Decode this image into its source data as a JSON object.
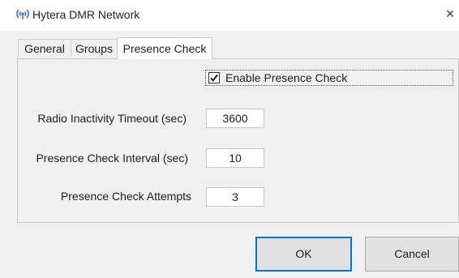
{
  "window": {
    "title": "Hytera DMR Network",
    "close_glyph": "×"
  },
  "tabs": [
    {
      "label": "General",
      "selected": false
    },
    {
      "label": "Groups",
      "selected": false
    },
    {
      "label": "Presence Check",
      "selected": true
    }
  ],
  "presence_check": {
    "enable_label": "Enable Presence Check",
    "enable_checked": true,
    "fields": [
      {
        "label": "Radio Inactivity Timeout (sec)",
        "value": "3600"
      },
      {
        "label": "Presence Check Interval (sec)",
        "value": "10"
      },
      {
        "label": "Presence Check Attempts",
        "value": "3"
      }
    ]
  },
  "buttons": {
    "ok_label": "OK",
    "cancel_label": "Cancel"
  },
  "icons": {
    "app": "radio-tower-icon",
    "close": "close-icon",
    "check": "checkmark-icon"
  },
  "colors": {
    "dialog_bg": "#f0f0f0",
    "default_button_border": "#0078d7",
    "app_icon": "#2b6cc4"
  }
}
